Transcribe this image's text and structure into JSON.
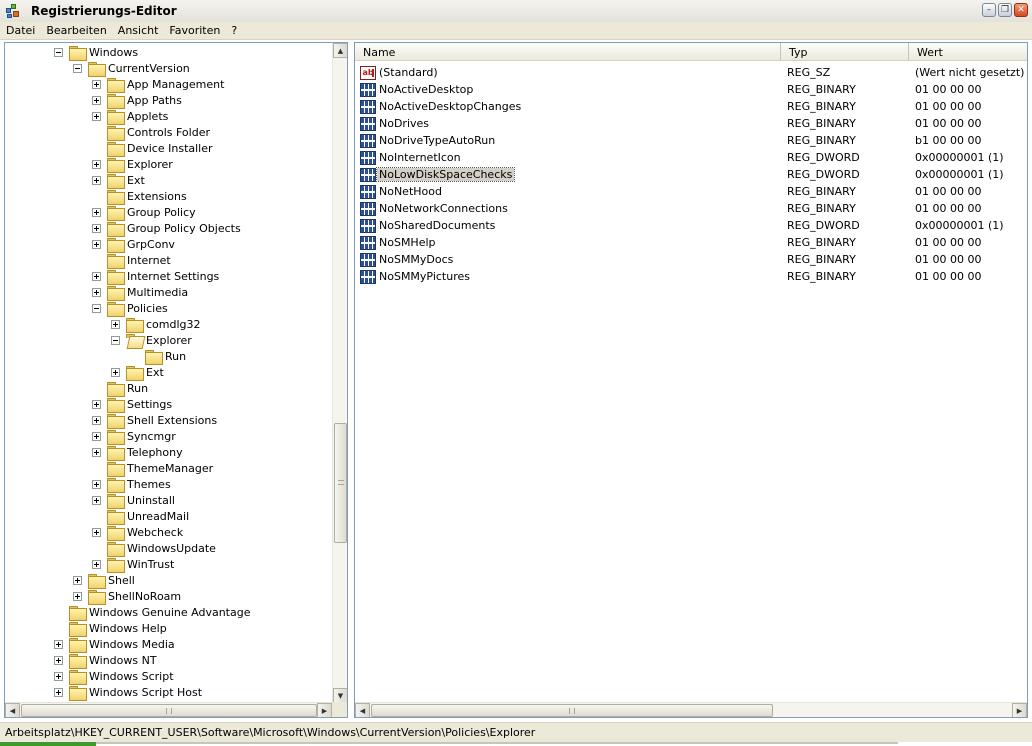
{
  "window": {
    "title": "Registrierungs-Editor"
  },
  "menu": [
    "Datei",
    "Bearbeiten",
    "Ansicht",
    "Favoriten",
    "?"
  ],
  "tree": [
    {
      "label": "Windows",
      "indent": 2,
      "exp": "minus",
      "open": false
    },
    {
      "label": "CurrentVersion",
      "indent": 3,
      "exp": "minus",
      "open": false
    },
    {
      "label": "App Management",
      "indent": 4,
      "exp": "plus",
      "open": false
    },
    {
      "label": "App Paths",
      "indent": 4,
      "exp": "plus",
      "open": false
    },
    {
      "label": "Applets",
      "indent": 4,
      "exp": "plus",
      "open": false
    },
    {
      "label": "Controls Folder",
      "indent": 4,
      "exp": "none",
      "open": false
    },
    {
      "label": "Device Installer",
      "indent": 4,
      "exp": "none",
      "open": false
    },
    {
      "label": "Explorer",
      "indent": 4,
      "exp": "plus",
      "open": false
    },
    {
      "label": "Ext",
      "indent": 4,
      "exp": "plus",
      "open": false
    },
    {
      "label": "Extensions",
      "indent": 4,
      "exp": "none",
      "open": false
    },
    {
      "label": "Group Policy",
      "indent": 4,
      "exp": "plus",
      "open": false
    },
    {
      "label": "Group Policy Objects",
      "indent": 4,
      "exp": "plus",
      "open": false
    },
    {
      "label": "GrpConv",
      "indent": 4,
      "exp": "plus",
      "open": false
    },
    {
      "label": "Internet",
      "indent": 4,
      "exp": "none",
      "open": false
    },
    {
      "label": "Internet Settings",
      "indent": 4,
      "exp": "plus",
      "open": false
    },
    {
      "label": "Multimedia",
      "indent": 4,
      "exp": "plus",
      "open": false
    },
    {
      "label": "Policies",
      "indent": 4,
      "exp": "minus",
      "open": false
    },
    {
      "label": "comdlg32",
      "indent": 5,
      "exp": "plus",
      "open": false
    },
    {
      "label": "Explorer",
      "indent": 5,
      "exp": "minus",
      "open": true
    },
    {
      "label": "Run",
      "indent": 6,
      "exp": "none",
      "open": false
    },
    {
      "label": "Ext",
      "indent": 5,
      "exp": "plus",
      "open": false
    },
    {
      "label": "Run",
      "indent": 4,
      "exp": "none",
      "open": false
    },
    {
      "label": "Settings",
      "indent": 4,
      "exp": "plus",
      "open": false
    },
    {
      "label": "Shell Extensions",
      "indent": 4,
      "exp": "plus",
      "open": false
    },
    {
      "label": "Syncmgr",
      "indent": 4,
      "exp": "plus",
      "open": false
    },
    {
      "label": "Telephony",
      "indent": 4,
      "exp": "plus",
      "open": false
    },
    {
      "label": "ThemeManager",
      "indent": 4,
      "exp": "none",
      "open": false
    },
    {
      "label": "Themes",
      "indent": 4,
      "exp": "plus",
      "open": false
    },
    {
      "label": "Uninstall",
      "indent": 4,
      "exp": "plus",
      "open": false
    },
    {
      "label": "UnreadMail",
      "indent": 4,
      "exp": "none",
      "open": false
    },
    {
      "label": "Webcheck",
      "indent": 4,
      "exp": "plus",
      "open": false
    },
    {
      "label": "WindowsUpdate",
      "indent": 4,
      "exp": "none",
      "open": false
    },
    {
      "label": "WinTrust",
      "indent": 4,
      "exp": "plus",
      "open": false
    },
    {
      "label": "Shell",
      "indent": 3,
      "exp": "plus",
      "open": false
    },
    {
      "label": "ShellNoRoam",
      "indent": 3,
      "exp": "plus",
      "open": false
    },
    {
      "label": "Windows Genuine Advantage",
      "indent": 2,
      "exp": "none",
      "open": false
    },
    {
      "label": "Windows Help",
      "indent": 2,
      "exp": "none",
      "open": false
    },
    {
      "label": "Windows Media",
      "indent": 2,
      "exp": "plus",
      "open": false
    },
    {
      "label": "Windows NT",
      "indent": 2,
      "exp": "plus",
      "open": false
    },
    {
      "label": "Windows Script",
      "indent": 2,
      "exp": "plus",
      "open": false
    },
    {
      "label": "Windows Script Host",
      "indent": 2,
      "exp": "plus",
      "open": false
    }
  ],
  "list": {
    "columns": [
      "Name",
      "Typ",
      "Wert"
    ],
    "rows": [
      {
        "name": "(Standard)",
        "type": "REG_SZ",
        "value": "(Wert nicht gesetzt)",
        "icon": "string",
        "selected": false
      },
      {
        "name": "NoActiveDesktop",
        "type": "REG_BINARY",
        "value": "01 00 00 00",
        "icon": "binary",
        "selected": false
      },
      {
        "name": "NoActiveDesktopChanges",
        "type": "REG_BINARY",
        "value": "01 00 00 00",
        "icon": "binary",
        "selected": false
      },
      {
        "name": "NoDrives",
        "type": "REG_BINARY",
        "value": "01 00 00 00",
        "icon": "binary",
        "selected": false
      },
      {
        "name": "NoDriveTypeAutoRun",
        "type": "REG_BINARY",
        "value": "b1 00 00 00",
        "icon": "binary",
        "selected": false
      },
      {
        "name": "NoInternetIcon",
        "type": "REG_DWORD",
        "value": "0x00000001 (1)",
        "icon": "binary",
        "selected": false
      },
      {
        "name": "NoLowDiskSpaceChecks",
        "type": "REG_DWORD",
        "value": "0x00000001 (1)",
        "icon": "binary",
        "selected": true
      },
      {
        "name": "NoNetHood",
        "type": "REG_BINARY",
        "value": "01 00 00 00",
        "icon": "binary",
        "selected": false
      },
      {
        "name": "NoNetworkConnections",
        "type": "REG_BINARY",
        "value": "01 00 00 00",
        "icon": "binary",
        "selected": false
      },
      {
        "name": "NoSharedDocuments",
        "type": "REG_DWORD",
        "value": "0x00000001 (1)",
        "icon": "binary",
        "selected": false
      },
      {
        "name": "NoSMHelp",
        "type": "REG_BINARY",
        "value": "01 00 00 00",
        "icon": "binary",
        "selected": false
      },
      {
        "name": "NoSMMyDocs",
        "type": "REG_BINARY",
        "value": "01 00 00 00",
        "icon": "binary",
        "selected": false
      },
      {
        "name": "NoSMMyPictures",
        "type": "REG_BINARY",
        "value": "01 00 00 00",
        "icon": "binary",
        "selected": false
      }
    ]
  },
  "statusbar": {
    "path": "Arbeitsplatz\\HKEY_CURRENT_USER\\Software\\Microsoft\\Windows\\CurrentVersion\\Policies\\Explorer"
  },
  "icons": {
    "minimize": "minimize-icon",
    "maximize": "restore-icon",
    "close": "close-icon",
    "app": "registry-editor-icon"
  }
}
